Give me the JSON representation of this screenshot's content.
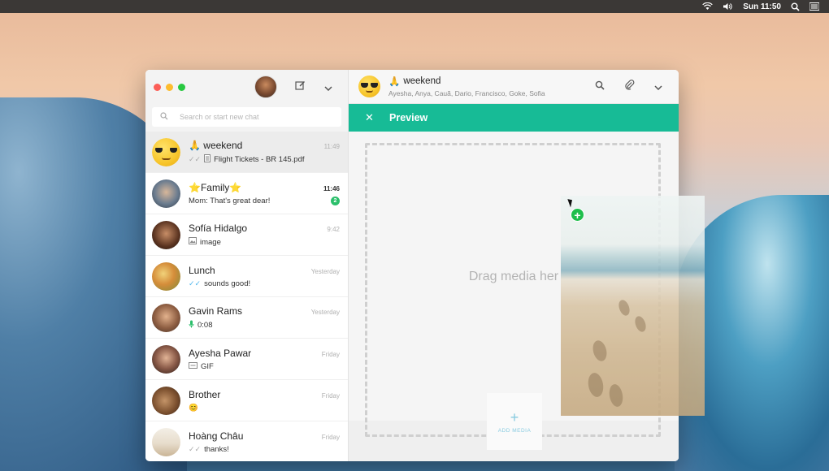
{
  "menubar": {
    "time": "Sun 11:50",
    "icons": [
      "wifi-icon",
      "volume-icon",
      "search-icon",
      "menu-icon"
    ]
  },
  "sidebar": {
    "search_placeholder": "Search or start new chat",
    "chats": [
      {
        "name": "weekend",
        "prefix": "🙏 ",
        "time": "11:49",
        "msg": "Flight Tickets - BR 145.pdf",
        "icon": "document-icon",
        "tick": "grey",
        "active": true,
        "avatar": "cool-emoji"
      },
      {
        "name": "Family",
        "prefix": "⭐",
        "suffix": "⭐",
        "time": "11:46",
        "msg": "Mom: That's great dear!",
        "badge": "2",
        "time_bold": true
      },
      {
        "name": "Sofía Hidalgo",
        "time": "9:42",
        "msg": "image",
        "icon": "image-icon"
      },
      {
        "name": "Lunch",
        "time": "Yesterday",
        "msg": "sounds good!",
        "tick": "blue"
      },
      {
        "name": "Gavin Rams",
        "time": "Yesterday",
        "msg": "0:08",
        "icon": "mic-icon"
      },
      {
        "name": "Ayesha Pawar",
        "time": "Friday",
        "msg": "GIF",
        "icon": "gif-icon"
      },
      {
        "name": "Brother",
        "time": "Friday",
        "msg": "😊"
      },
      {
        "name": "Hoàng Châu",
        "time": "Friday",
        "msg": "thanks!",
        "tick": "grey"
      }
    ]
  },
  "main": {
    "group_name": "weekend",
    "group_prefix": "🙏",
    "members": "Ayesha, Anya, Cauã, Dario, Francisco, Goke, Sofia",
    "preview_title": "Preview",
    "drop_hint": "Drag media her",
    "add_media_label": "ADD MEDIA"
  },
  "colors": {
    "accent": "#17bb96",
    "badge": "#2bbf6b",
    "tick_blue": "#4fb6ec"
  }
}
